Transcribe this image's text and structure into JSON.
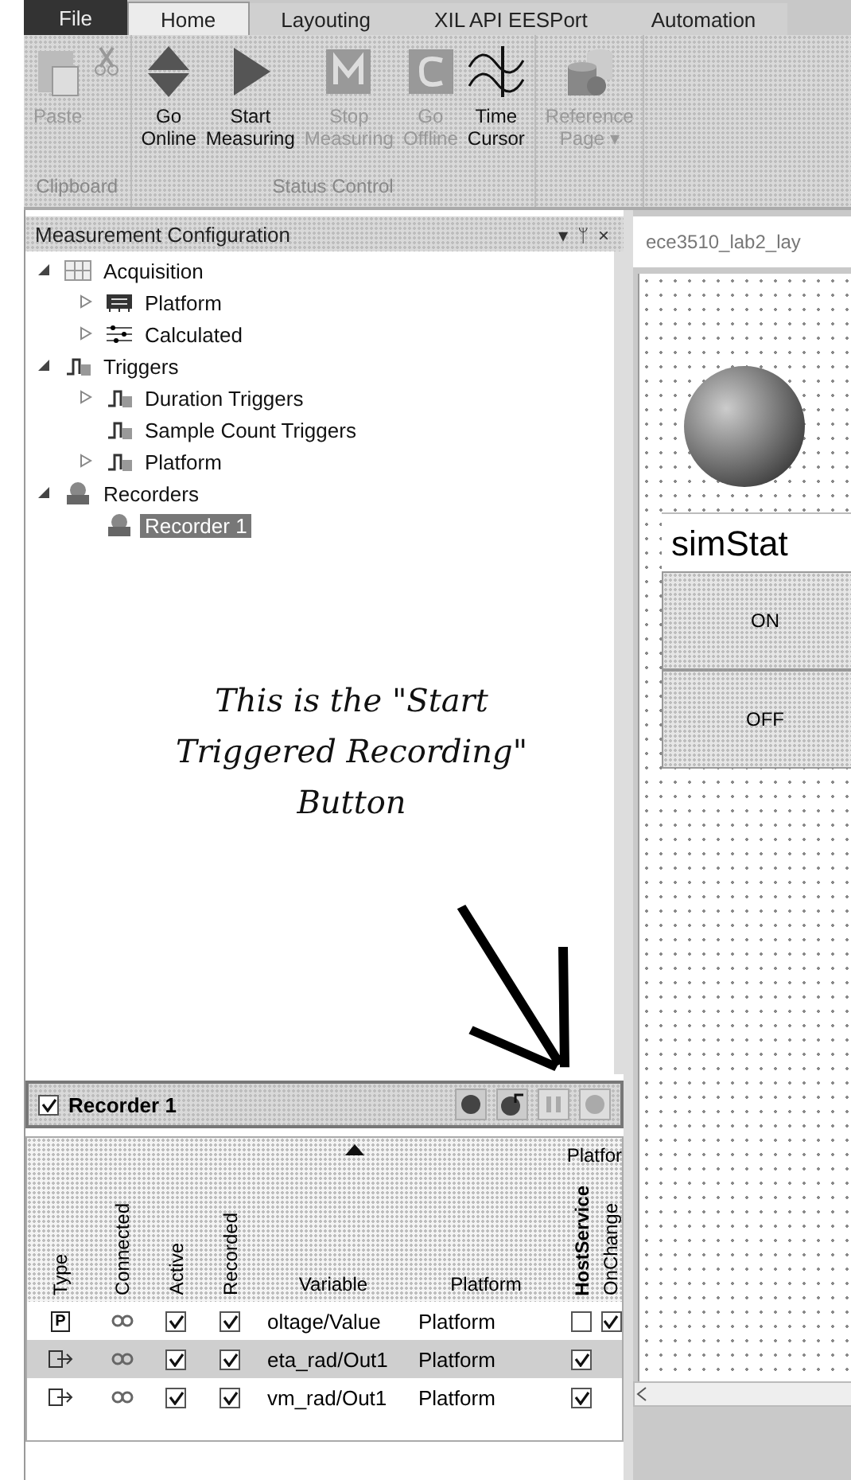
{
  "ribbon_tabs": [
    {
      "label": "File",
      "kind": "file",
      "selected": false
    },
    {
      "label": "Home",
      "kind": "tab",
      "selected": true
    },
    {
      "label": "Layouting",
      "kind": "tab",
      "selected": false
    },
    {
      "label": "XIL API EESPort",
      "kind": "tab",
      "selected": false
    },
    {
      "label": "Automation",
      "kind": "tab",
      "selected": false
    }
  ],
  "ribbon_groups": [
    {
      "label": "Clipboard",
      "buttons": [
        {
          "label": "Paste",
          "kind": "paste",
          "disabled": true
        },
        {
          "kind": "cut",
          "disabled": true
        }
      ]
    },
    {
      "label": "Status Control",
      "buttons": [
        {
          "label": "Go\nOnline",
          "kind": "updown",
          "disabled": false
        },
        {
          "label": "Start\nMeasuring",
          "kind": "play",
          "disabled": false
        },
        {
          "label": "Stop\nMeasuring",
          "kind": "m",
          "disabled": true
        },
        {
          "label": "Go\nOffline",
          "kind": "c",
          "disabled": true
        },
        {
          "label": "Time\nCursor",
          "kind": "wave",
          "disabled": false
        }
      ]
    },
    {
      "buttons": [
        {
          "label": "Reference\nPage ▾",
          "kind": "db",
          "disabled": true
        }
      ]
    }
  ],
  "panel": {
    "title": "Measurement Configuration",
    "controls": [
      "▾",
      "ᛘ",
      "×"
    ]
  },
  "tree": [
    {
      "label": "Acquisition",
      "kind": "grid",
      "expanded": true,
      "selected": false,
      "children": [
        {
          "label": "Platform",
          "kind": "board",
          "expanded": false,
          "selected": false
        },
        {
          "label": "Calculated",
          "kind": "sliders",
          "expanded": false,
          "selected": false
        }
      ]
    },
    {
      "label": "Triggers",
      "kind": "trigger",
      "expanded": true,
      "selected": false,
      "children": [
        {
          "label": "Duration Triggers",
          "kind": "trigger",
          "expanded": false,
          "selected": false
        },
        {
          "label": "Sample Count Triggers",
          "kind": "trigger",
          "selected": false
        },
        {
          "label": "Platform",
          "kind": "trigger",
          "expanded": false,
          "selected": false
        }
      ]
    },
    {
      "label": "Recorders",
      "kind": "recorder",
      "expanded": true,
      "selected": false,
      "children": [
        {
          "label": "Recorder 1",
          "kind": "recorder",
          "selected": true
        }
      ]
    }
  ],
  "annotation": "This is the \"Start Triggered Recording\" Button",
  "recorder": {
    "label": "Recorder 1",
    "checked": true,
    "buttons": [
      {
        "kind": "record",
        "disabled": false
      },
      {
        "kind": "trigger-record",
        "disabled": false
      },
      {
        "kind": "pause",
        "disabled": true
      },
      {
        "kind": "record",
        "disabled": true
      }
    ]
  },
  "table": {
    "group_header": "Platfor",
    "columns": [
      "Type",
      "Connected",
      "Active",
      "Recorded",
      "Variable",
      "Platform",
      "HostService",
      "OnChange"
    ],
    "rows": [
      {
        "type": "P",
        "kind": "parameter",
        "active": true,
        "recorded": true,
        "variable": "oltage/Value",
        "platform": "Platform",
        "host_service": false,
        "on_change": true,
        "selected": false
      },
      {
        "kind": "output",
        "active": true,
        "recorded": true,
        "variable": "eta_rad/Out1",
        "platform": "Platform",
        "host_service": true,
        "selected": true
      },
      {
        "kind": "output",
        "active": true,
        "recorded": true,
        "variable": "vm_rad/Out1",
        "platform": "Platform",
        "host_service": true,
        "selected": false
      }
    ]
  },
  "document": {
    "tab": "ece3510_lab2_lay",
    "label": "simStat",
    "buttons": [
      "ON",
      "OFF"
    ]
  }
}
